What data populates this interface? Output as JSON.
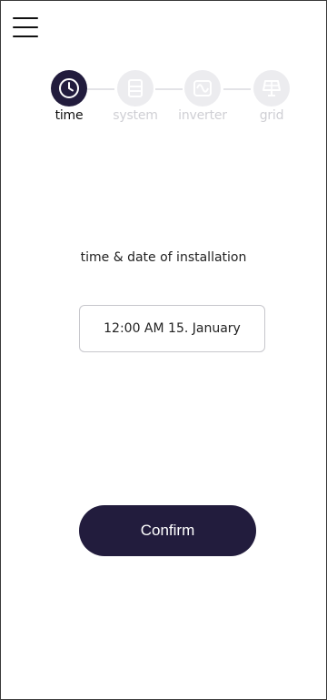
{
  "menu": {
    "icon": "hamburger-menu-icon"
  },
  "stepper": {
    "steps": [
      {
        "label": "time",
        "icon": "clock-icon",
        "active": true
      },
      {
        "label": "system",
        "icon": "system-icon",
        "active": false
      },
      {
        "label": "inverter",
        "icon": "inverter-icon",
        "active": false
      },
      {
        "label": "grid",
        "icon": "solar-grid-icon",
        "active": false
      }
    ]
  },
  "form": {
    "label": "time & date of installation",
    "value": "12:00 AM 15. January"
  },
  "actions": {
    "confirm_label": "Confirm"
  },
  "colors": {
    "accent": "#221c3d",
    "inactive_step": "#ececef",
    "inactive_text": "#cfcfd4"
  }
}
